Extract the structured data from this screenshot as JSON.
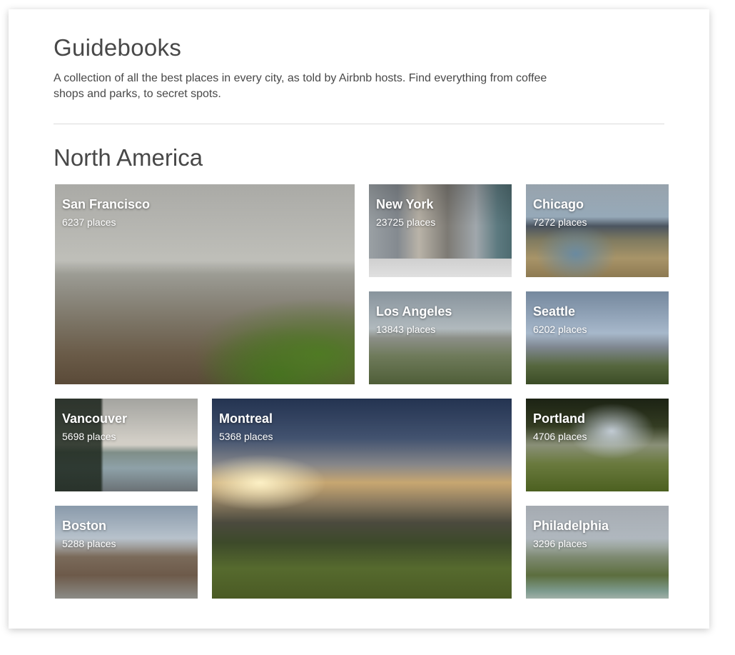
{
  "header": {
    "title": "Guidebooks",
    "description": "A collection of all the best places in every city, as told by Airbnb hosts. Find everything from coffee shops and parks, to secret spots."
  },
  "region": {
    "title": "North America"
  },
  "guides": [
    {
      "name": "San Francisco",
      "count": "6237 places"
    },
    {
      "name": "New York",
      "count": "23725 places"
    },
    {
      "name": "Chicago",
      "count": "7272 places"
    },
    {
      "name": "Los Angeles",
      "count": "13843 places"
    },
    {
      "name": "Seattle",
      "count": "6202 places"
    },
    {
      "name": "Vancouver",
      "count": "5698 places"
    },
    {
      "name": "Montreal",
      "count": "5368 places"
    },
    {
      "name": "Portland",
      "count": "4706 places"
    },
    {
      "name": "Boston",
      "count": "5288 places"
    },
    {
      "name": "Philadelphia",
      "count": "3296 places"
    }
  ]
}
